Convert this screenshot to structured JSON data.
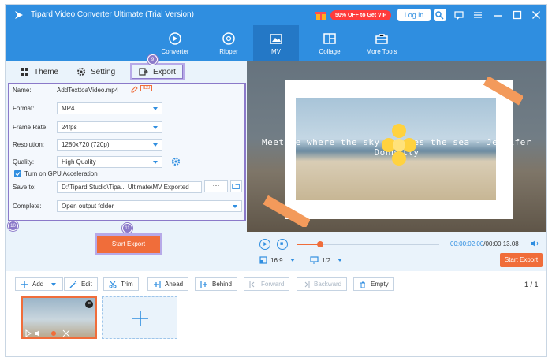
{
  "window": {
    "title": "Tipard Video Converter Ultimate (Trial Version)",
    "promo": "50% OFF to Get VIP",
    "login": "Log in"
  },
  "nav": [
    {
      "label": "Converter",
      "icon": "converter-icon"
    },
    {
      "label": "Ripper",
      "icon": "ripper-icon"
    },
    {
      "label": "MV",
      "icon": "mv-icon",
      "active": true
    },
    {
      "label": "Collage",
      "icon": "collage-icon"
    },
    {
      "label": "More Tools",
      "icon": "toolbox-icon"
    }
  ],
  "tabs": {
    "theme": "Theme",
    "setting": "Setting",
    "export": "Export"
  },
  "markers": {
    "export_tab": "9",
    "form": "10",
    "start": "11"
  },
  "export": {
    "name_label": "Name:",
    "name": "AddTexttoaVideo.mp4",
    "id_badge": "ID3",
    "format_label": "Format:",
    "format": "MP4",
    "framerate_label": "Frame Rate:",
    "framerate": "24fps",
    "resolution_label": "Resolution:",
    "resolution": "1280x720 (720p)",
    "quality_label": "Quality:",
    "quality": "High Quality",
    "gpu_label": "Turn on GPU Acceleration",
    "saveto_label": "Save to:",
    "saveto": "D:\\Tipard Studio\\Tipa... Ultimate\\MV Exported",
    "browse": "···",
    "complete_label": "Complete:",
    "complete": "Open output folder",
    "start_export": "Start Export"
  },
  "preview": {
    "caption": "Meet me where the sky touches the sea - Jennifer Donnelly",
    "time_current": "00:00:02.00",
    "time_total": "/00:00:13.08",
    "progress": 0.16,
    "aspect": "16:9",
    "page": "1/2",
    "start_export": "Start Export"
  },
  "toolbar": {
    "add": "Add",
    "edit": "Edit",
    "trim": "Trim",
    "ahead": "Ahead",
    "behind": "Behind",
    "forward": "Forward",
    "backward": "Backward",
    "empty": "Empty",
    "count": "1 / 1"
  },
  "colors": {
    "primary": "#2f8ee0",
    "accent": "#f06d3a",
    "marker": "#8b79c9"
  }
}
